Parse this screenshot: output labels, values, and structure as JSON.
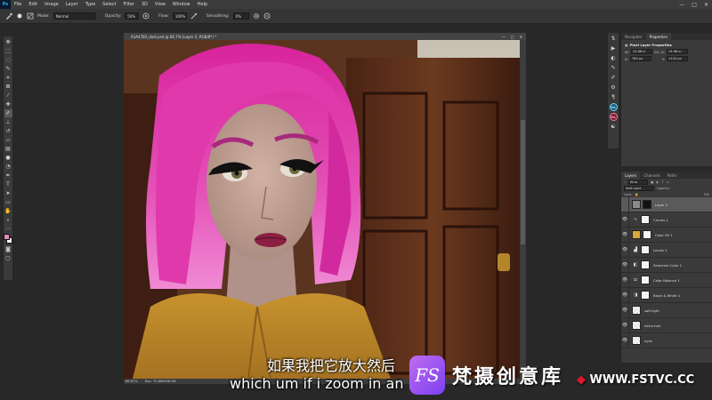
{
  "menubar": {
    "logo": "Ps",
    "items": [
      "File",
      "Edit",
      "Image",
      "Layer",
      "Type",
      "Select",
      "Filter",
      "3D",
      "View",
      "Window",
      "Help"
    ],
    "window_controls": [
      "—",
      "□",
      "✕"
    ]
  },
  "options": {
    "mode_label": "Mode:",
    "mode_value": "Normal",
    "opacity_label": "Opacity:",
    "opacity_value": "50%",
    "flow_label": "Flow:",
    "flow_value": "100%",
    "smoothing_label": "Smoothing:",
    "smoothing_value": "0%"
  },
  "document": {
    "tab_title": "A1A4783_dodi.psd @ 66.7% (Layer 2, RGB/8*) *",
    "zoom": "66.67%",
    "doc_size": "Doc: 75.8M/906.4M"
  },
  "properties": {
    "tabs": [
      "Navigator",
      "Properties"
    ],
    "active_tab": "Properties",
    "title": "Pixel Layer Properties",
    "w_label": "W:",
    "w_value": "12.88 in",
    "h_label": "H:",
    "h_value": "13.96 in",
    "x_label": "X:",
    "x_value": "780 px",
    "y_label": "Y:",
    "y_value": "1120 px",
    "go_label": "GO"
  },
  "iconstrip": {
    "ra1": "RA",
    "ra2": "RA"
  },
  "layers_panel": {
    "tabs": [
      "Layers",
      "Channels",
      "Paths"
    ],
    "active_tab": "Layers",
    "filter_label": "Kind",
    "blend_value": "Soft Light",
    "opacity_label": "Opacity:",
    "lock_label": "Lock:",
    "fill_label": "Fill:",
    "layers": [
      {
        "name": "Layer 2",
        "selected": true,
        "thumb": "gray",
        "icon": "none"
      },
      {
        "name": "Curves 1",
        "selected": false,
        "thumb": "adj",
        "icon": "curves-icon"
      },
      {
        "name": "Color Fill 1",
        "selected": false,
        "thumb": "#d9a640",
        "icon": "none"
      },
      {
        "name": "Levels 1",
        "selected": false,
        "thumb": "adj",
        "icon": "levels-icon"
      },
      {
        "name": "Selective Color 1",
        "selected": false,
        "thumb": "adj",
        "icon": "selective-color-icon"
      },
      {
        "name": "Color Balance 1",
        "selected": false,
        "thumb": "adj",
        "icon": "color-balance-icon"
      },
      {
        "name": "Black & White 1",
        "selected": false,
        "thumb": "adj",
        "icon": "black-white-icon"
      },
      {
        "name": "soft light",
        "selected": false,
        "thumb": "checker",
        "icon": "none"
      },
      {
        "name": "extra hair",
        "selected": false,
        "thumb": "checker",
        "icon": "none"
      },
      {
        "name": "eyes",
        "selected": false,
        "thumb": "checker",
        "icon": "none"
      }
    ]
  },
  "subtitles": {
    "chinese": "如果我把它放大然后",
    "english": "which um if i zoom in an"
  },
  "watermark": {
    "logo": "FS",
    "brand": "梵摄创意库",
    "url_mark": "◆",
    "url": "WWW.FSTVC.CC"
  },
  "colors": {
    "accent": "#d63fa8",
    "foreground_swatch": "#e28ab8",
    "background_swatch": "#ffffff"
  }
}
